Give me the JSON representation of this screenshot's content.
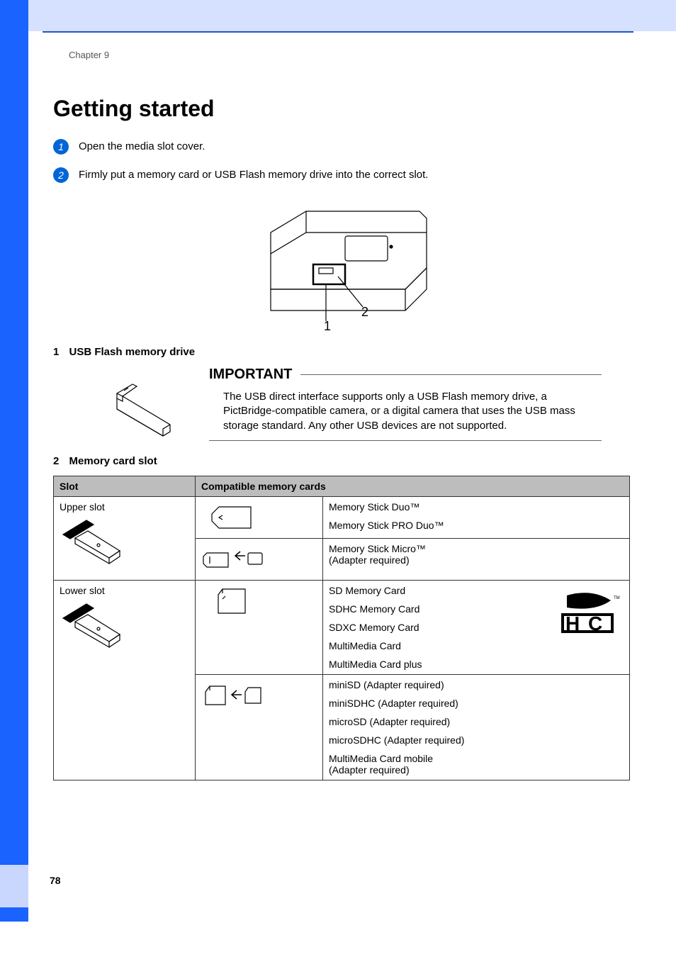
{
  "chapter": "Chapter 9",
  "title": "Getting started",
  "steps": [
    {
      "num": "1",
      "text": "Open the media slot cover."
    },
    {
      "num": "2",
      "text": "Firmly put a memory card or USB Flash memory drive into the correct slot."
    }
  ],
  "figure": {
    "callout1": "1",
    "callout2": "2"
  },
  "sub1": {
    "num": "1",
    "label": "USB Flash memory drive"
  },
  "important": {
    "heading": "IMPORTANT",
    "text": "The USB direct interface supports only a USB Flash memory drive, a PictBridge-compatible camera, or a digital camera that uses the USB mass storage standard. Any other USB devices are not supported."
  },
  "sub2": {
    "num": "2",
    "label": "Memory card slot"
  },
  "table": {
    "headers": {
      "slot": "Slot",
      "compat": "Compatible memory cards"
    },
    "upper": {
      "label": "Upper slot",
      "row1": [
        "Memory Stick Duo™",
        "Memory Stick PRO Duo™"
      ],
      "row2_line1": "Memory Stick Micro™",
      "row2_line2": "(Adapter required)"
    },
    "lower": {
      "label": "Lower slot",
      "row1": [
        "SD Memory Card",
        "SDHC Memory Card",
        "SDXC Memory Card",
        "MultiMedia Card",
        "MultiMedia Card plus"
      ],
      "row2": [
        "miniSD (Adapter required)",
        "miniSDHC (Adapter required)",
        "microSD (Adapter required)",
        "microSDHC (Adapter required)"
      ],
      "row2_last_line1": "MultiMedia Card mobile",
      "row2_last_line2": "(Adapter required)"
    }
  },
  "page_number": "78"
}
